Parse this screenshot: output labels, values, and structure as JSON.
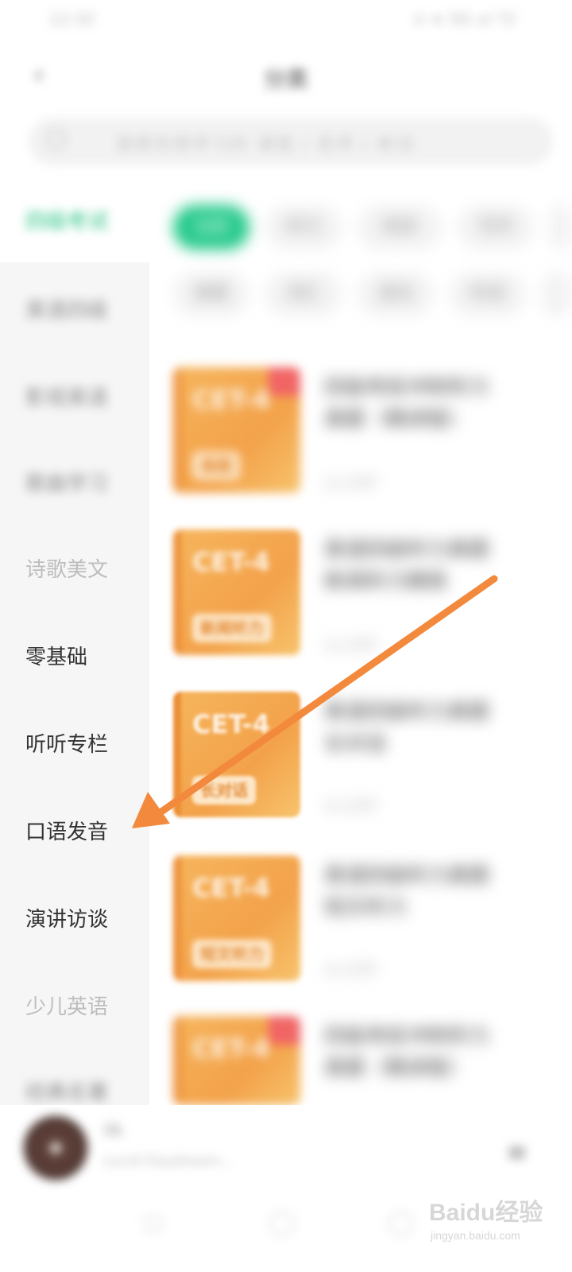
{
  "status": {
    "time": "12:32",
    "indicators": "⊙ ≋ 5G ul 72"
  },
  "header": {
    "title": "分类",
    "back_icon": "back-arrow-icon"
  },
  "search": {
    "placeholder": "搜索你想学习的 课程 / 老师 / 单词"
  },
  "sidebar": {
    "items": [
      {
        "label": "四级考试",
        "state": "active-blurred"
      },
      {
        "label": "英语四级",
        "state": "blurred"
      },
      {
        "label": "影视英语",
        "state": "blurred"
      },
      {
        "label": "歌曲学习",
        "state": "blurred"
      },
      {
        "label": "诗歌美文",
        "state": "faint"
      },
      {
        "label": "零基础",
        "state": "normal"
      },
      {
        "label": "听听专栏",
        "state": "normal"
      },
      {
        "label": "口语发音",
        "state": "normal"
      },
      {
        "label": "演讲访谈",
        "state": "normal"
      },
      {
        "label": "少儿英语",
        "state": "faint"
      },
      {
        "label": "经典名著",
        "state": "blurred"
      }
    ]
  },
  "chips": {
    "row1": [
      "全部",
      "听力",
      "阅读",
      "写作",
      "翻译"
    ],
    "row2": [
      "真题",
      "词汇",
      "语法",
      "听说",
      "口语"
    ]
  },
  "courses": [
    {
      "cover_title": "CET-4",
      "cover_tag": "真题",
      "title": "四级考前冲刺听力真题（精讲版）",
      "meta": "0人已学",
      "corner_badge": true
    },
    {
      "cover_title": "CET-4",
      "cover_tag": "新闻听力",
      "title": "英语四级听力真题新闻听力精练",
      "meta": "0人已学",
      "corner_badge": false
    },
    {
      "cover_title": "CET-4",
      "cover_tag": "长对话",
      "title": "英语四级听力真题长对话",
      "meta": "0人已学",
      "corner_badge": false
    },
    {
      "cover_title": "CET-4",
      "cover_tag": "短文听力",
      "title": "英语四级听力真题短文听力",
      "meta": "0人已学",
      "corner_badge": false
    },
    {
      "cover_title": "CET-4",
      "cover_tag": "",
      "title": "四级考前冲刺听力真题（精讲版）",
      "meta": "",
      "corner_badge": true
    }
  ],
  "player": {
    "title": "ilk",
    "subtitle": "Lucid Daydream...",
    "playlist_icon": "playlist-icon"
  },
  "nav": {
    "icons": [
      "home-icon",
      "discover-icon",
      "profile-icon"
    ]
  },
  "watermark": {
    "brand": "Baidu经验",
    "url": "jingyan.baidu.com"
  },
  "colors": {
    "accent": "#23c98a",
    "annotation_arrow": "#f2893c",
    "card": "#f3a24a"
  }
}
